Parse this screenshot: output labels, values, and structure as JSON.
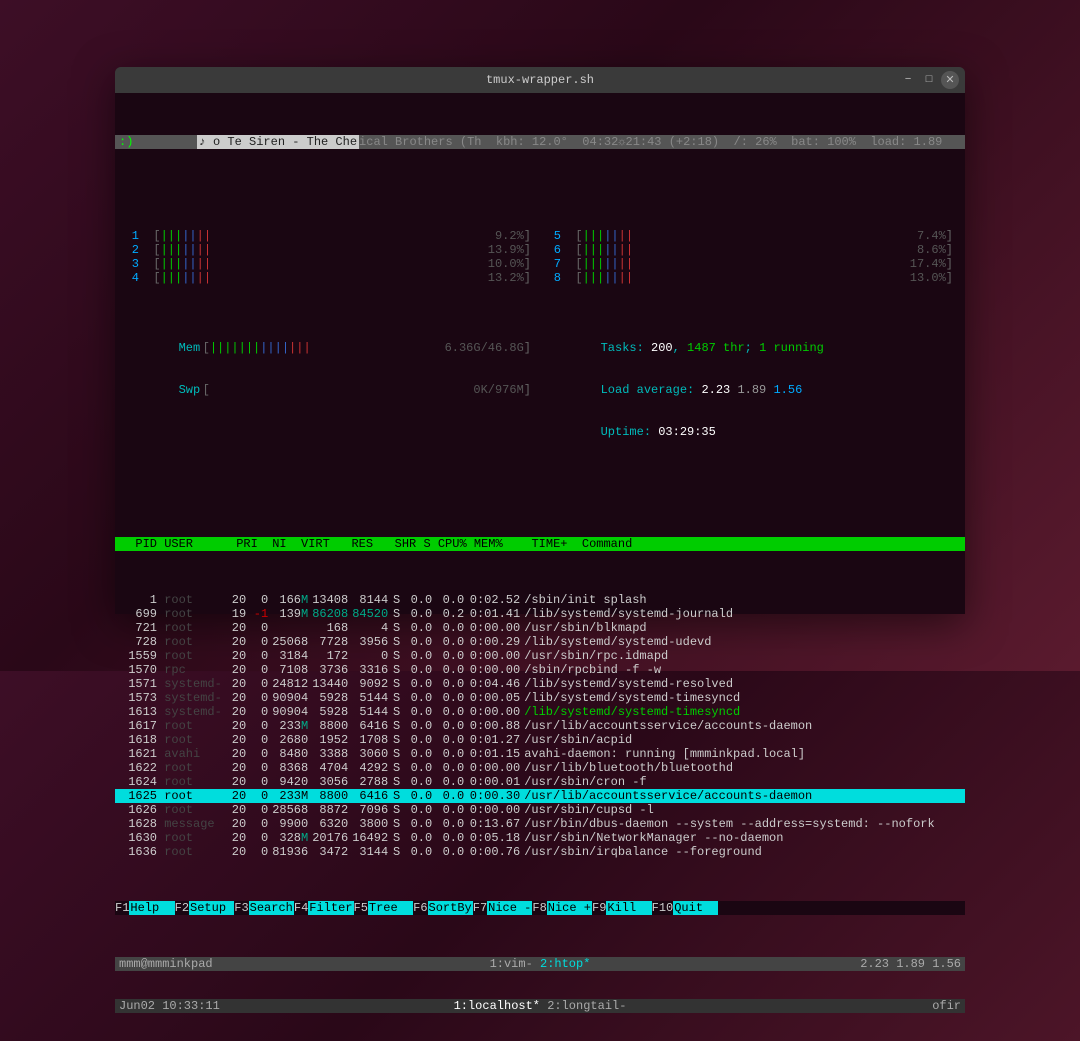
{
  "window": {
    "title": "tmux-wrapper.sh"
  },
  "status": {
    "smiley": ":)",
    "mpd": "♪ o Te Siren - The Che",
    "mpd_rest": "ical Brothers (Th",
    "info": "  kbh: 12.0°  04:32☼21:43 (+2:18)  /: 26%  bat: 100%  load: 1.89"
  },
  "cpus_left": [
    {
      "n": "1",
      "pct": "9.2%"
    },
    {
      "n": "2",
      "pct": "13.9%"
    },
    {
      "n": "3",
      "pct": "10.0%"
    },
    {
      "n": "4",
      "pct": "13.2%"
    }
  ],
  "cpus_right": [
    {
      "n": "5",
      "pct": "7.4%"
    },
    {
      "n": "6",
      "pct": "8.6%"
    },
    {
      "n": "7",
      "pct": "17.4%"
    },
    {
      "n": "8",
      "pct": "13.0%"
    }
  ],
  "mem": {
    "label": "Mem",
    "val": "6.36G/46.8G"
  },
  "swp": {
    "label": "Swp",
    "val": "0K/976M"
  },
  "tasks": {
    "label": "Tasks: ",
    "procs": "200",
    "sep": ", ",
    "thr": "1487 thr",
    "sep2": "; ",
    "run": "1 running"
  },
  "loadavg": {
    "label": "Load average: ",
    "v1": "2.23",
    "v2": "1.89",
    "v3": "1.56"
  },
  "uptime": {
    "label": "Uptime: ",
    "val": "03:29:35"
  },
  "header": "  PID USER      PRI  NI  VIRT   RES   SHR S CPU% MEM%    TIME+  Command",
  "procs": [
    {
      "pid": "1",
      "user": "root",
      "pri": "20",
      "ni": "0",
      "virt": "166M",
      "res": "13408",
      "shr": "8144",
      "st": "S",
      "cpu": "0.0",
      "mem": "0.0",
      "time": "0:02.52",
      "cmd": "/sbin/init splash"
    },
    {
      "pid": "699",
      "user": "root",
      "pri": "19",
      "ni": "-1",
      "virt": "139M",
      "res": "86208",
      "shr": "84520",
      "st": "S",
      "cpu": "0.0",
      "mem": "0.2",
      "time": "0:01.41",
      "cmd": "/lib/systemd/systemd-journald"
    },
    {
      "pid": "721",
      "user": "root",
      "pri": "20",
      "ni": "0",
      "virt": "",
      "res": "168",
      "shr": "4",
      "st": "S",
      "cpu": "0.0",
      "mem": "0.0",
      "time": "0:00.00",
      "cmd": "/usr/sbin/blkmapd"
    },
    {
      "pid": "728",
      "user": "root",
      "pri": "20",
      "ni": "0",
      "virt": "25068",
      "res": "7728",
      "shr": "3956",
      "st": "S",
      "cpu": "0.0",
      "mem": "0.0",
      "time": "0:00.29",
      "cmd": "/lib/systemd/systemd-udevd"
    },
    {
      "pid": "1559",
      "user": "root",
      "pri": "20",
      "ni": "0",
      "virt": "3184",
      "res": "172",
      "shr": "0",
      "st": "S",
      "cpu": "0.0",
      "mem": "0.0",
      "time": "0:00.00",
      "cmd": "/usr/sbin/rpc.idmapd"
    },
    {
      "pid": "1570",
      "user": "rpc",
      "pri": "20",
      "ni": "0",
      "virt": "7108",
      "res": "3736",
      "shr": "3316",
      "st": "S",
      "cpu": "0.0",
      "mem": "0.0",
      "time": "0:00.00",
      "cmd": "/sbin/rpcbind -f -w"
    },
    {
      "pid": "1571",
      "user": "systemd-",
      "pri": "20",
      "ni": "0",
      "virt": "24812",
      "res": "13440",
      "shr": "9092",
      "st": "S",
      "cpu": "0.0",
      "mem": "0.0",
      "time": "0:04.46",
      "cmd": "/lib/systemd/systemd-resolved"
    },
    {
      "pid": "1573",
      "user": "systemd-",
      "pri": "20",
      "ni": "0",
      "virt": "90904",
      "res": "5928",
      "shr": "5144",
      "st": "S",
      "cpu": "0.0",
      "mem": "0.0",
      "time": "0:00.05",
      "cmd": "/lib/systemd/systemd-timesyncd"
    },
    {
      "pid": "1613",
      "user": "systemd-",
      "pri": "20",
      "ni": "0",
      "virt": "90904",
      "res": "5928",
      "shr": "5144",
      "st": "S",
      "cpu": "0.0",
      "mem": "0.0",
      "time": "0:00.00",
      "cmd": "/lib/systemd/systemd-timesyncd",
      "green": true
    },
    {
      "pid": "1617",
      "user": "root",
      "pri": "20",
      "ni": "0",
      "virt": "233M",
      "res": "8800",
      "shr": "6416",
      "st": "S",
      "cpu": "0.0",
      "mem": "0.0",
      "time": "0:00.88",
      "cmd": "/usr/lib/accountsservice/accounts-daemon"
    },
    {
      "pid": "1618",
      "user": "root",
      "pri": "20",
      "ni": "0",
      "virt": "2680",
      "res": "1952",
      "shr": "1708",
      "st": "S",
      "cpu": "0.0",
      "mem": "0.0",
      "time": "0:01.27",
      "cmd": "/usr/sbin/acpid"
    },
    {
      "pid": "1621",
      "user": "avahi",
      "pri": "20",
      "ni": "0",
      "virt": "8480",
      "res": "3388",
      "shr": "3060",
      "st": "S",
      "cpu": "0.0",
      "mem": "0.0",
      "time": "0:01.15",
      "cmd": "avahi-daemon: running [mmminkpad.local]"
    },
    {
      "pid": "1622",
      "user": "root",
      "pri": "20",
      "ni": "0",
      "virt": "8368",
      "res": "4704",
      "shr": "4292",
      "st": "S",
      "cpu": "0.0",
      "mem": "0.0",
      "time": "0:00.00",
      "cmd": "/usr/lib/bluetooth/bluetoothd"
    },
    {
      "pid": "1624",
      "user": "root",
      "pri": "20",
      "ni": "0",
      "virt": "9420",
      "res": "3056",
      "shr": "2788",
      "st": "S",
      "cpu": "0.0",
      "mem": "0.0",
      "time": "0:00.01",
      "cmd": "/usr/sbin/cron -f"
    },
    {
      "pid": "1625",
      "user": "root",
      "pri": "20",
      "ni": "0",
      "virt": "233M",
      "res": "8800",
      "shr": "6416",
      "st": "S",
      "cpu": "0.0",
      "mem": "0.0",
      "time": "0:00.30",
      "cmd": "/usr/lib/accountsservice/accounts-daemon",
      "sel": true
    },
    {
      "pid": "1626",
      "user": "root",
      "pri": "20",
      "ni": "0",
      "virt": "28568",
      "res": "8872",
      "shr": "7096",
      "st": "S",
      "cpu": "0.0",
      "mem": "0.0",
      "time": "0:00.00",
      "cmd": "/usr/sbin/cupsd -l"
    },
    {
      "pid": "1628",
      "user": "message",
      "pri": "20",
      "ni": "0",
      "virt": "9900",
      "res": "6320",
      "shr": "3800",
      "st": "S",
      "cpu": "0.0",
      "mem": "0.0",
      "time": "0:13.67",
      "cmd": "/usr/bin/dbus-daemon --system --address=systemd: --nofork"
    },
    {
      "pid": "1630",
      "user": "root",
      "pri": "20",
      "ni": "0",
      "virt": "328M",
      "res": "20176",
      "shr": "16492",
      "st": "S",
      "cpu": "0.0",
      "mem": "0.0",
      "time": "0:05.18",
      "cmd": "/usr/sbin/NetworkManager --no-daemon"
    },
    {
      "pid": "1636",
      "user": "root",
      "pri": "20",
      "ni": "0",
      "virt": "81936",
      "res": "3472",
      "shr": "3144",
      "st": "S",
      "cpu": "0.0",
      "mem": "0.0",
      "time": "0:00.76",
      "cmd": "/usr/sbin/irqbalance --foreground"
    }
  ],
  "fkeys": [
    {
      "k": "F1",
      "l": "Help  "
    },
    {
      "k": "F2",
      "l": "Setup "
    },
    {
      "k": "F3",
      "l": "Search"
    },
    {
      "k": "F4",
      "l": "Filter"
    },
    {
      "k": "F5",
      "l": "Tree  "
    },
    {
      "k": "F6",
      "l": "SortBy"
    },
    {
      "k": "F7",
      "l": "Nice -"
    },
    {
      "k": "F8",
      "l": "Nice +"
    },
    {
      "k": "F9",
      "l": "Kill  "
    },
    {
      "k": "F10",
      "l": "Quit  "
    }
  ],
  "tmux1": {
    "left": "mmm@mmminkpad",
    "center_a": "1:vim- ",
    "center_b": "2:htop*",
    "right": "2.23 1.89 1.56"
  },
  "tmux2": {
    "left": "Jun02 10:33:11",
    "center": "1:localhost* 2:longtail-",
    "right": "ofir"
  }
}
